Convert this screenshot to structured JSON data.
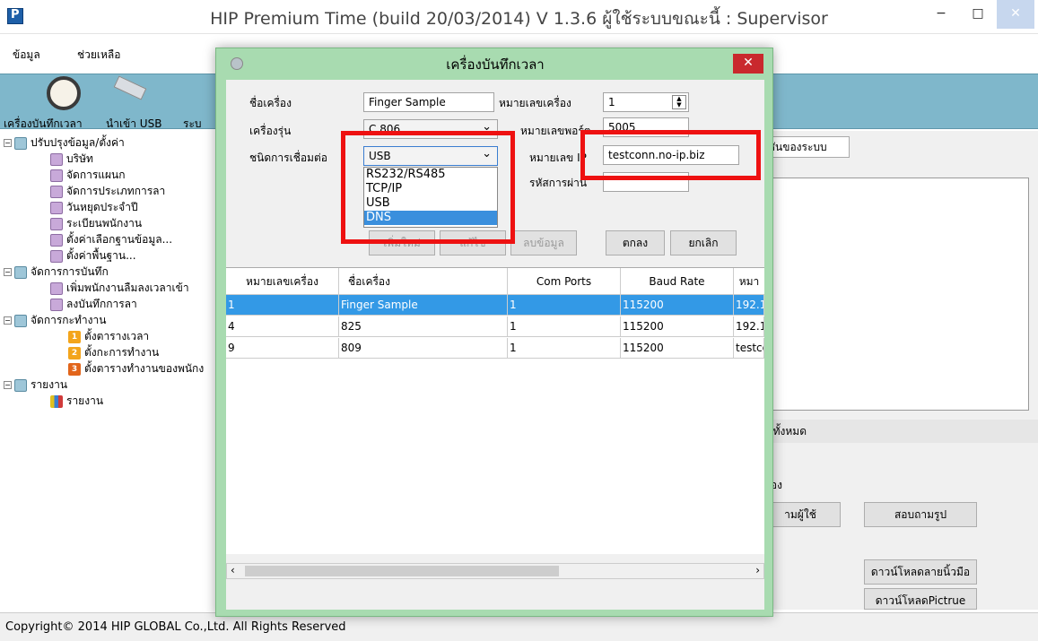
{
  "window": {
    "title": "HIP Premium Time (build 20/03/2014) V 1.3.6  ผู้ใช้ระบบขณะนี้ : Supervisor",
    "minimize": "−",
    "maximize": "□",
    "close": "✕"
  },
  "menu": {
    "items": [
      "ข้อมูล",
      "ช่วยเหลือ"
    ]
  },
  "toolbar": {
    "items": [
      "เครื่องบันทึกเวลา",
      "นำเข้า USB",
      "ระบ"
    ]
  },
  "tree": {
    "items": [
      "ปรับปรุงข้อมูล/ตั้งค่า",
      "บริษัท",
      "จัดการแผนก",
      "จัดการประเภทการลา",
      "วันหยุดประจำปี",
      "ระเบียนพนักงาน",
      "ตั้งค่าเลือกฐานข้อมูล...",
      "ตั้งค่าพื้นฐาน...",
      "จัดการการบันทึก",
      "เพิ่มพนักงานลืมลงเวลาเข้า",
      "ลงบันทึกการลา",
      "จัดการกะทำงาน",
      "ตั้งตารางเวลา",
      "ตั้งกะการทำงาน",
      "ตั้งตารางทำงานของพนักง",
      "รายงาน",
      "รายงาน"
    ],
    "badges": [
      "1",
      "2",
      "3"
    ]
  },
  "right_panel": {
    "tab_fragment": "ท์ชันของระบบ",
    "cancel_all": "ลิกทั้งหมด",
    "self_label": "ตเอง",
    "btn_user": "ามผู้ใช้",
    "btn_photo": "สอบถามรูป",
    "btn_fingerprint": "ดาวน์โหลดลายนิ้วมือ",
    "btn_picture_log": "ดาวน์โหลดPictrue Log"
  },
  "dialog": {
    "title": "เครื่องบันทึกเวลา",
    "close": "✕",
    "labels": {
      "device_name": "ชื่อเครื่อง",
      "model": "เครื่องรุ่น",
      "connection_type": "ชนิดการเชื่อมต่อ",
      "device_number": "หมายเลขเครื่อง",
      "port_number": "หมายเลขพอร์ต",
      "ip_number": "หมายเลข IP",
      "password": "รหัสการผ่าน"
    },
    "values": {
      "device_name": "Finger Sample",
      "model": "C 806",
      "connection_type": "USB",
      "device_number": "1",
      "port_number": "5005",
      "ip_number": "testconn.no-ip.biz",
      "password": ""
    },
    "connection_options": [
      "RS232/RS485",
      "TCP/IP",
      "USB",
      "DNS"
    ],
    "connection_highlighted": "DNS",
    "buttons": {
      "new": "เพิ่มใหม่",
      "edit": "แก้ไข",
      "delete": "ลบข้อมูล",
      "ok": "ตกลง",
      "cancel": "ยกเลิก"
    },
    "grid": {
      "columns": [
        "หมายเลขเครื่อง",
        "ชื่อเครื่อง",
        "Com Ports",
        "Baud Rate",
        "หมา"
      ],
      "rows": [
        [
          "1",
          "Finger Sample",
          "1",
          "115200",
          "192.1"
        ],
        [
          "4",
          "825",
          "1",
          "115200",
          "192.1"
        ],
        [
          "9",
          "809",
          "1",
          "115200",
          "testco"
        ]
      ]
    }
  },
  "status": {
    "copyright": "Copyright© 2014 HIP GLOBAL Co.,Ltd. All Rights Reserved"
  },
  "colors": {
    "dialog_frame": "#a8dbb0",
    "toolbar": "#7fb7cb",
    "selection": "#3399e6",
    "highlight_box": "#ee1111"
  }
}
